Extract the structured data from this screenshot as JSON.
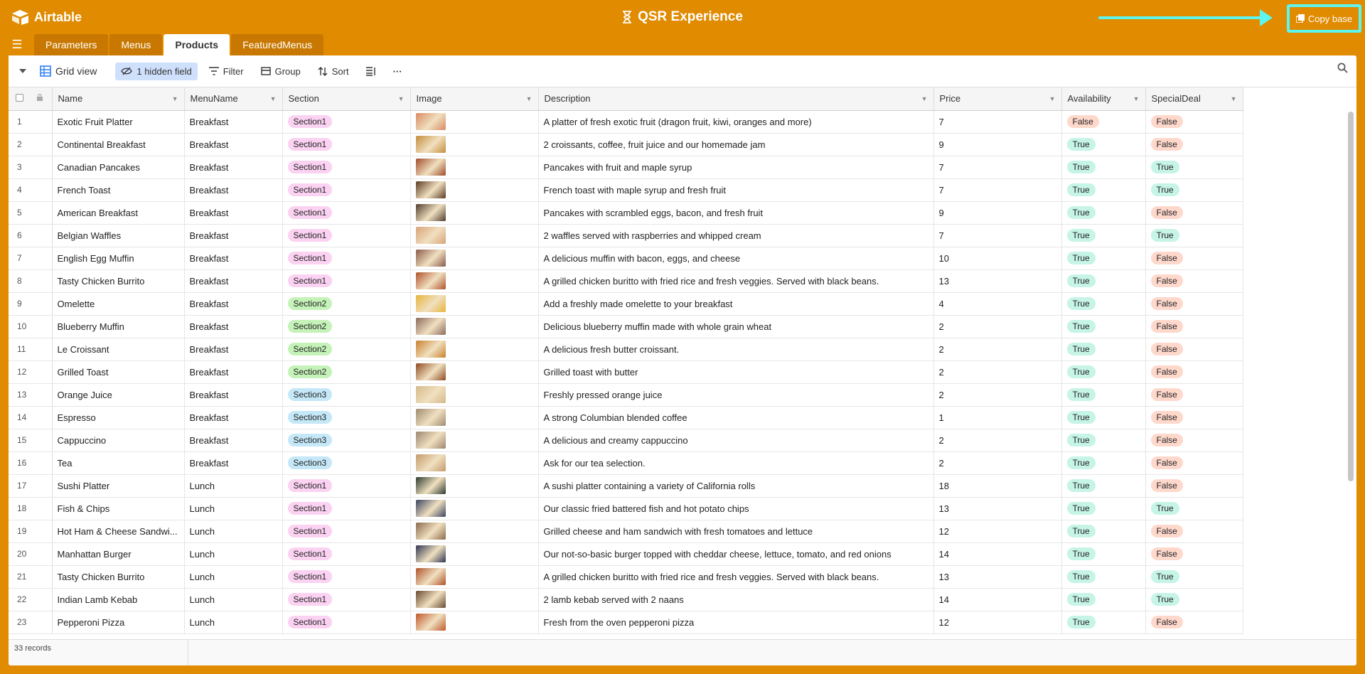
{
  "app": {
    "name": "Airtable"
  },
  "base": {
    "title": "QSR Experience",
    "copy_label": "Copy base"
  },
  "tabs": [
    {
      "label": "Parameters",
      "active": false
    },
    {
      "label": "Menus",
      "active": false
    },
    {
      "label": "Products",
      "active": true
    },
    {
      "label": "FeaturedMenus",
      "active": false
    }
  ],
  "toolbar": {
    "view_label": "Grid view",
    "hidden_fields": "1 hidden field",
    "filter": "Filter",
    "group": "Group",
    "sort": "Sort",
    "more": "···"
  },
  "columns": [
    "Name",
    "MenuName",
    "Section",
    "Image",
    "Description",
    "Price",
    "Availability",
    "SpecialDeal"
  ],
  "rows": [
    {
      "n": "1",
      "name": "Exotic Fruit Platter",
      "menu": "Breakfast",
      "section": "Section1",
      "img": "#d98a60",
      "desc": "A platter of fresh exotic fruit (dragon fruit, kiwi, oranges and more)",
      "price": "7",
      "avail": "False",
      "deal": "False"
    },
    {
      "n": "2",
      "name": "Continental Breakfast",
      "menu": "Breakfast",
      "section": "Section1",
      "img": "#c58d3b",
      "desc": "2 croissants, coffee, fruit juice and our homemade jam",
      "price": "9",
      "avail": "True",
      "deal": "False"
    },
    {
      "n": "3",
      "name": "Canadian Pancakes",
      "menu": "Breakfast",
      "section": "Section1",
      "img": "#a04c2b",
      "desc": "Pancakes with fruit and maple syrup",
      "price": "7",
      "avail": "True",
      "deal": "True"
    },
    {
      "n": "4",
      "name": "French Toast",
      "menu": "Breakfast",
      "section": "Section1",
      "img": "#5b3a22",
      "desc": "French toast with maple syrup and fresh fruit",
      "price": "7",
      "avail": "True",
      "deal": "True"
    },
    {
      "n": "5",
      "name": "American Breakfast",
      "menu": "Breakfast",
      "section": "Section1",
      "img": "#4e3c2c",
      "desc": "Pancakes with scrambled eggs, bacon, and fresh fruit",
      "price": "9",
      "avail": "True",
      "deal": "False"
    },
    {
      "n": "6",
      "name": "Belgian Waffles",
      "menu": "Breakfast",
      "section": "Section1",
      "img": "#d9a37a",
      "desc": "2 waffles served with raspberries and whipped cream",
      "price": "7",
      "avail": "True",
      "deal": "True"
    },
    {
      "n": "7",
      "name": "English Egg Muffin",
      "menu": "Breakfast",
      "section": "Section1",
      "img": "#8a5a4a",
      "desc": "A delicious muffin with bacon, eggs, and cheese",
      "price": "10",
      "avail": "True",
      "deal": "False"
    },
    {
      "n": "8",
      "name": "Tasty Chicken Burrito",
      "menu": "Breakfast",
      "section": "Section1",
      "img": "#b0522a",
      "desc": "A grilled chicken buritto with fried rice and fresh veggies. Served with black beans.",
      "price": "13",
      "avail": "True",
      "deal": "False"
    },
    {
      "n": "9",
      "name": "Omelette",
      "menu": "Breakfast",
      "section": "Section2",
      "img": "#e8b43a",
      "desc": "Add a freshly made omelette to your breakfast",
      "price": "4",
      "avail": "True",
      "deal": "False"
    },
    {
      "n": "10",
      "name": "Blueberry Muffin",
      "menu": "Breakfast",
      "section": "Section2",
      "img": "#8c6a5c",
      "desc": "Delicious blueberry muffin made with whole grain wheat",
      "price": "2",
      "avail": "True",
      "deal": "False"
    },
    {
      "n": "11",
      "name": "Le Croissant",
      "menu": "Breakfast",
      "section": "Section2",
      "img": "#c9812e",
      "desc": "A delicious fresh butter croissant.",
      "price": "2",
      "avail": "True",
      "deal": "False"
    },
    {
      "n": "12",
      "name": "Grilled Toast",
      "menu": "Breakfast",
      "section": "Section2",
      "img": "#8e4a20",
      "desc": "Grilled toast with butter",
      "price": "2",
      "avail": "True",
      "deal": "False"
    },
    {
      "n": "13",
      "name": "Orange Juice",
      "menu": "Breakfast",
      "section": "Section3",
      "img": "#d5b98a",
      "desc": "Freshly pressed orange juice",
      "price": "2",
      "avail": "True",
      "deal": "False"
    },
    {
      "n": "14",
      "name": "Espresso",
      "menu": "Breakfast",
      "section": "Section3",
      "img": "#a08a70",
      "desc": "A strong Columbian blended coffee",
      "price": "1",
      "avail": "True",
      "deal": "False"
    },
    {
      "n": "15",
      "name": "Cappuccino",
      "menu": "Breakfast",
      "section": "Section3",
      "img": "#9c8570",
      "desc": "A delicious and creamy cappuccino",
      "price": "2",
      "avail": "True",
      "deal": "False"
    },
    {
      "n": "16",
      "name": "Tea",
      "menu": "Breakfast",
      "section": "Section3",
      "img": "#c49a6a",
      "desc": "Ask for our tea selection.",
      "price": "2",
      "avail": "True",
      "deal": "False"
    },
    {
      "n": "17",
      "name": "Sushi Platter",
      "menu": "Lunch",
      "section": "Section1",
      "img": "#2c3a30",
      "desc": "A sushi platter containing a variety of California rolls",
      "price": "18",
      "avail": "True",
      "deal": "False"
    },
    {
      "n": "18",
      "name": "Fish & Chips",
      "menu": "Lunch",
      "section": "Section1",
      "img": "#3a4460",
      "desc": "Our classic fried battered fish and hot potato chips",
      "price": "13",
      "avail": "True",
      "deal": "True"
    },
    {
      "n": "19",
      "name": "Hot Ham & Cheese Sandwi...",
      "menu": "Lunch",
      "section": "Section1",
      "img": "#8a6a4c",
      "desc": "Grilled cheese and ham sandwich with fresh tomatoes and lettuce",
      "price": "12",
      "avail": "True",
      "deal": "False"
    },
    {
      "n": "20",
      "name": "Manhattan Burger",
      "menu": "Lunch",
      "section": "Section1",
      "img": "#2e3550",
      "desc": "Our not-so-basic burger topped with cheddar cheese, lettuce, tomato, and red onions",
      "price": "14",
      "avail": "True",
      "deal": "False"
    },
    {
      "n": "21",
      "name": "Tasty Chicken Burrito",
      "menu": "Lunch",
      "section": "Section1",
      "img": "#b0522a",
      "desc": "A grilled chicken buritto with fried rice and fresh veggies. Served with black beans.",
      "price": "13",
      "avail": "True",
      "deal": "True"
    },
    {
      "n": "22",
      "name": "Indian Lamb Kebab",
      "menu": "Lunch",
      "section": "Section1",
      "img": "#6a4a30",
      "desc": "2 lamb kebab served with 2 naans",
      "price": "14",
      "avail": "True",
      "deal": "True"
    },
    {
      "n": "23",
      "name": "Pepperoni Pizza",
      "menu": "Lunch",
      "section": "Section1",
      "img": "#c0582a",
      "desc": "Fresh from the oven pepperoni pizza",
      "price": "12",
      "avail": "True",
      "deal": "False"
    }
  ],
  "footer": {
    "record_count": "33 records"
  }
}
